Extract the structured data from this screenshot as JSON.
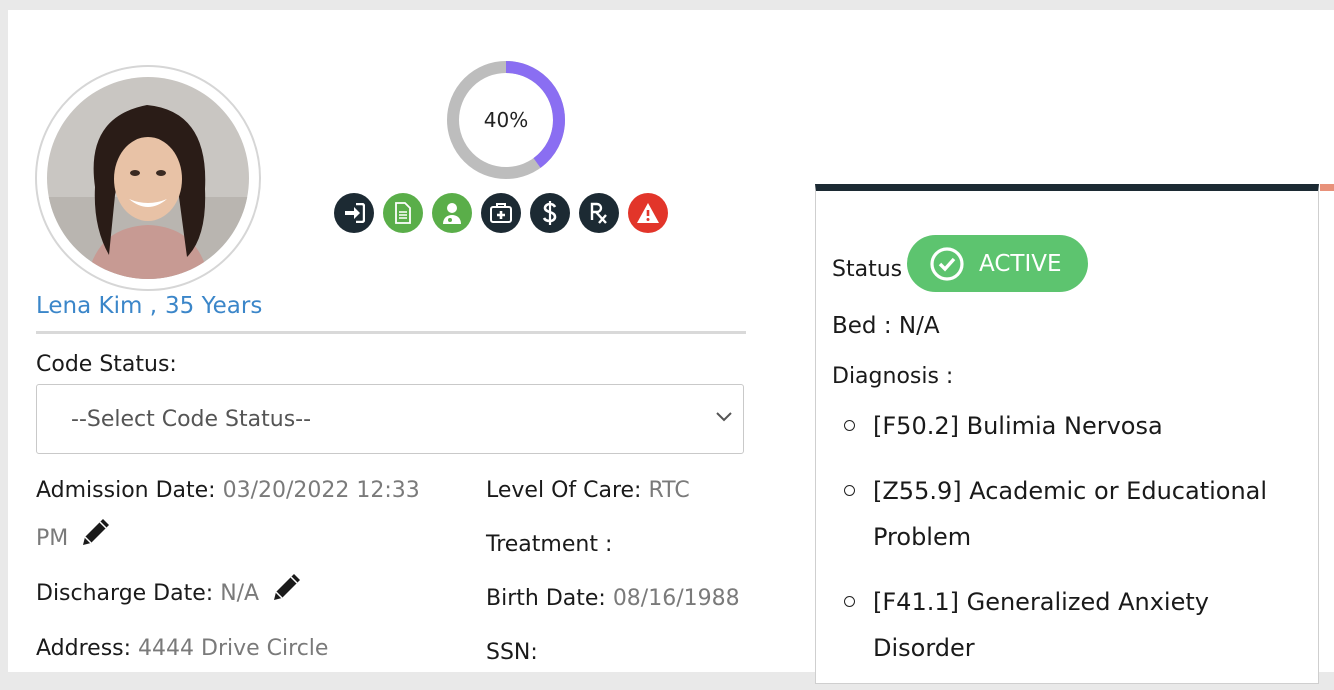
{
  "patient": {
    "name": "Lena Kim ,",
    "age": "35 Years"
  },
  "progress": {
    "percent_label": "40%",
    "value": 0.4,
    "colors": {
      "fill": "#8a6ef2",
      "track": "#bdbdbd"
    }
  },
  "action_icons": [
    {
      "name": "sign-in-icon",
      "color": "#1c2a33"
    },
    {
      "name": "document-icon",
      "color": "#5aae49"
    },
    {
      "name": "doctor-icon",
      "color": "#5aae49"
    },
    {
      "name": "medical-kit-icon",
      "color": "#1c2a33"
    },
    {
      "name": "dollar-icon",
      "color": "#1c2a33"
    },
    {
      "name": "rx-icon",
      "color": "#1c2a33"
    },
    {
      "name": "alert-icon",
      "color": "#e2352a"
    }
  ],
  "code_status": {
    "label": "Code Status:",
    "selected": "--Select Code Status--"
  },
  "details": {
    "admission_label": "Admission Date:",
    "admission_value_1": "03/20/2022 12:33",
    "admission_value_2": "PM",
    "level_label": "Level Of Care:",
    "level_value": "RTC",
    "treatment_label": "Treatment :",
    "discharge_label": "Discharge Date:",
    "discharge_value": "N/A",
    "birth_label": "Birth Date:",
    "birth_value": "08/16/1988",
    "address_label": "Address:",
    "address_value": "4444 Drive Circle",
    "ssn_label": "SSN:"
  },
  "summary": {
    "status_label": "Status",
    "status_value": "ACTIVE",
    "status_color": "#5dc46f",
    "bed": "Bed : N/A",
    "diagnosis_label": "Diagnosis :",
    "diagnoses": [
      "[F50.2] Bulimia Nervosa",
      "[Z55.9] Academic or Educational Problem",
      "[F41.1] Generalized Anxiety Disorder"
    ]
  }
}
